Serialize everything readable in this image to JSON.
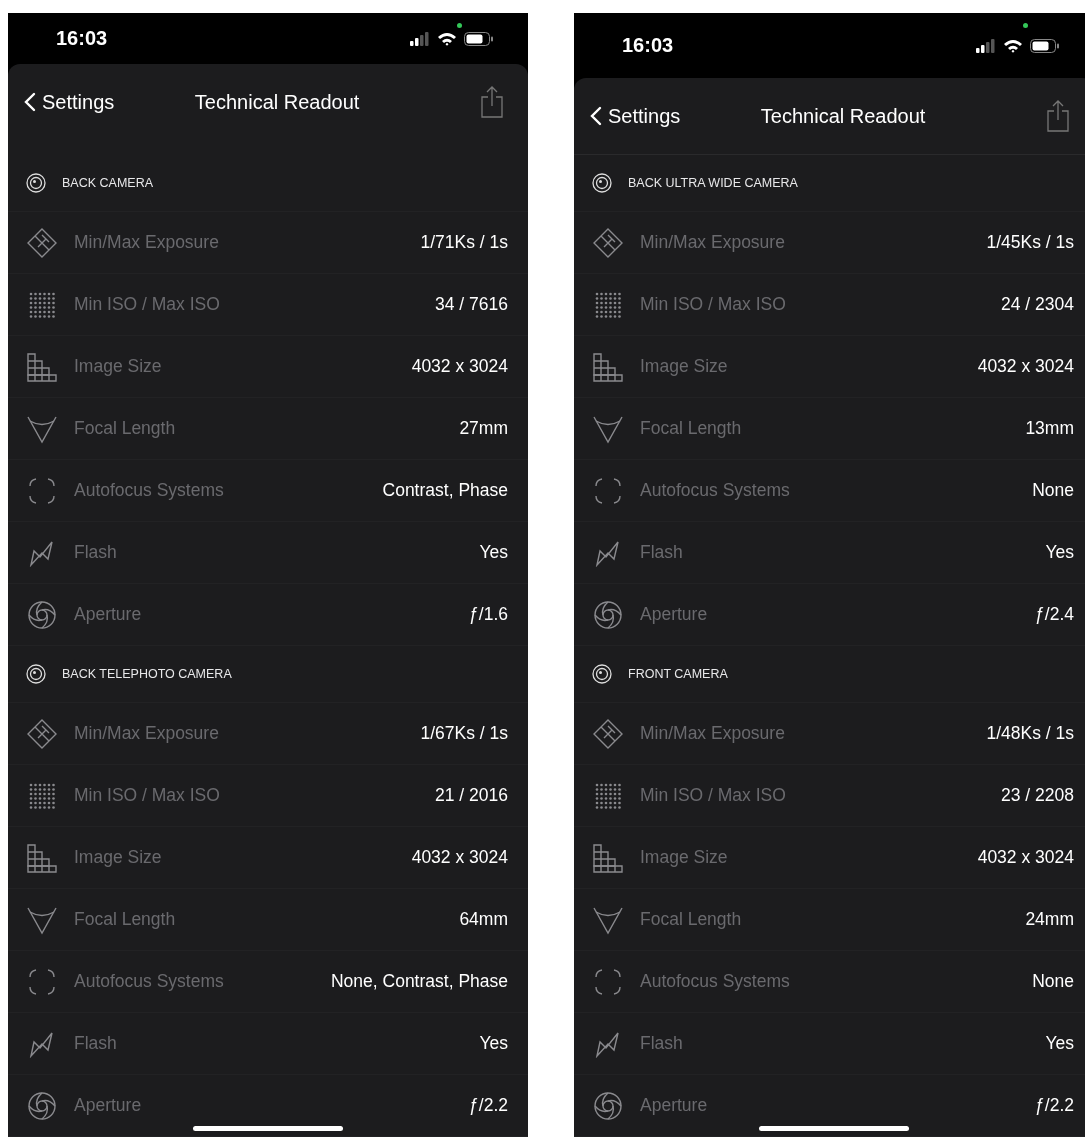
{
  "phones": [
    {
      "status_bar": {
        "time": "16:03"
      },
      "nav": {
        "back": "Settings",
        "title": "Technical Readout"
      },
      "scrolled": false,
      "sections": [
        {
          "title": "BACK CAMERA",
          "rows": [
            {
              "kind": "exposure",
              "label": "Min/Max Exposure",
              "value": "1/71Ks / 1s"
            },
            {
              "kind": "iso",
              "label": "Min ISO / Max ISO",
              "value": "34 / 7616"
            },
            {
              "kind": "image_size",
              "label": "Image Size",
              "value": "4032 x 3024"
            },
            {
              "kind": "focal_length",
              "label": "Focal Length",
              "value": "27mm"
            },
            {
              "kind": "autofocus",
              "label": "Autofocus Systems",
              "value": "Contrast, Phase"
            },
            {
              "kind": "flash",
              "label": "Flash",
              "value": "Yes"
            },
            {
              "kind": "aperture",
              "label": "Aperture",
              "value": "ƒ/1.6"
            }
          ]
        },
        {
          "title": "BACK TELEPHOTO CAMERA",
          "rows": [
            {
              "kind": "exposure",
              "label": "Min/Max Exposure",
              "value": "1/67Ks / 1s"
            },
            {
              "kind": "iso",
              "label": "Min ISO / Max ISO",
              "value": "21 / 2016"
            },
            {
              "kind": "image_size",
              "label": "Image Size",
              "value": "4032 x 3024"
            },
            {
              "kind": "focal_length",
              "label": "Focal Length",
              "value": "64mm"
            },
            {
              "kind": "autofocus",
              "label": "Autofocus Systems",
              "value": "None, Contrast, Phase"
            },
            {
              "kind": "flash",
              "label": "Flash",
              "value": "Yes"
            },
            {
              "kind": "aperture",
              "label": "Aperture",
              "value": "ƒ/2.2"
            }
          ]
        }
      ]
    },
    {
      "status_bar": {
        "time": "16:03"
      },
      "nav": {
        "back": "Settings",
        "title": "Technical Readout"
      },
      "scrolled": true,
      "sections": [
        {
          "title": "BACK ULTRA WIDE CAMERA",
          "rows": [
            {
              "kind": "exposure",
              "label": "Min/Max Exposure",
              "value": "1/45Ks / 1s"
            },
            {
              "kind": "iso",
              "label": "Min ISO / Max ISO",
              "value": "24 / 2304"
            },
            {
              "kind": "image_size",
              "label": "Image Size",
              "value": "4032 x 3024"
            },
            {
              "kind": "focal_length",
              "label": "Focal Length",
              "value": "13mm"
            },
            {
              "kind": "autofocus",
              "label": "Autofocus Systems",
              "value": "None"
            },
            {
              "kind": "flash",
              "label": "Flash",
              "value": "Yes"
            },
            {
              "kind": "aperture",
              "label": "Aperture",
              "value": "ƒ/2.4"
            }
          ]
        },
        {
          "title": "FRONT CAMERA",
          "rows": [
            {
              "kind": "exposure",
              "label": "Min/Max Exposure",
              "value": "1/48Ks / 1s"
            },
            {
              "kind": "iso",
              "label": "Min ISO / Max ISO",
              "value": "23 / 2208"
            },
            {
              "kind": "image_size",
              "label": "Image Size",
              "value": "4032 x 3024"
            },
            {
              "kind": "focal_length",
              "label": "Focal Length",
              "value": "24mm"
            },
            {
              "kind": "autofocus",
              "label": "Autofocus Systems",
              "value": "None"
            },
            {
              "kind": "flash",
              "label": "Flash",
              "value": "Yes"
            },
            {
              "kind": "aperture",
              "label": "Aperture",
              "value": "ƒ/2.2"
            }
          ]
        }
      ]
    }
  ]
}
